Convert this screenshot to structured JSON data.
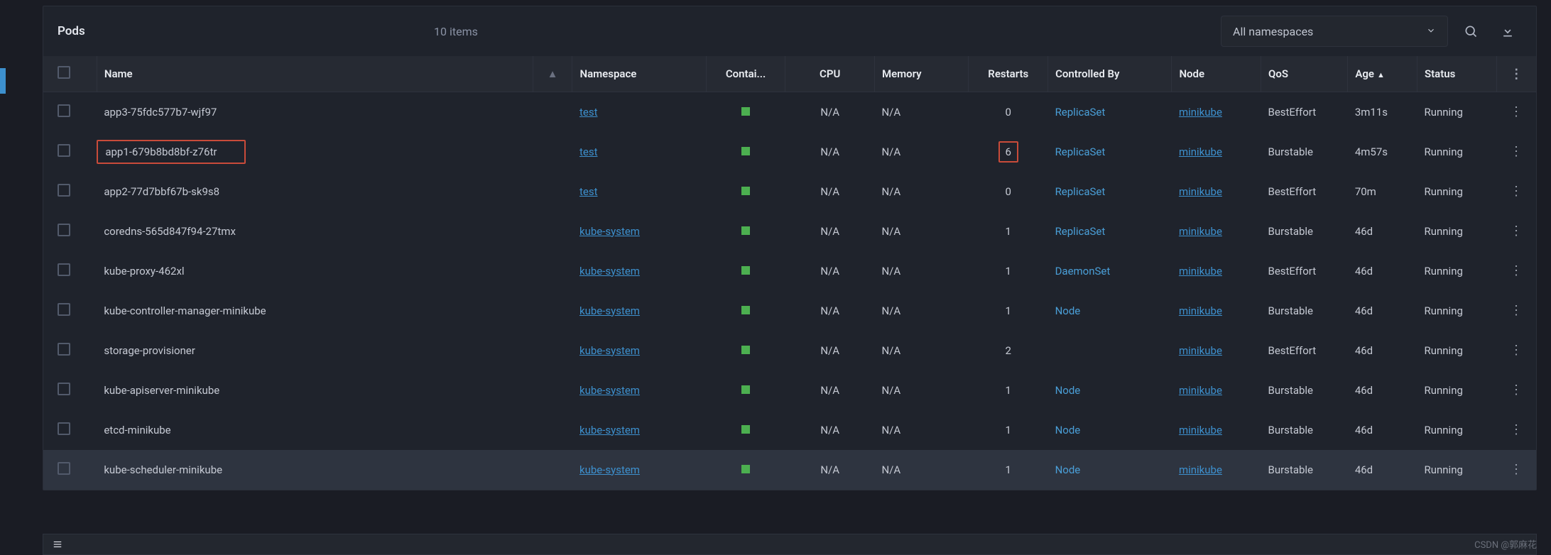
{
  "header": {
    "title": "Pods",
    "count": "10 items",
    "namespace_select": "All namespaces"
  },
  "columns": {
    "name": "Name",
    "namespace": "Namespace",
    "containers": "Contai...",
    "cpu": "CPU",
    "memory": "Memory",
    "restarts": "Restarts",
    "controlled_by": "Controlled By",
    "node": "Node",
    "qos": "QoS",
    "age": "Age",
    "status": "Status"
  },
  "rows": [
    {
      "name": "app3-75fdc577b7-wjf97",
      "ns": "test",
      "cpu": "N/A",
      "mem": "N/A",
      "restarts": "0",
      "ctrl": "ReplicaSet",
      "node": "minikube",
      "qos": "BestEffort",
      "age": "3m11s",
      "status": "Running",
      "highlight_name": false,
      "highlight_restarts": false
    },
    {
      "name": "app1-679b8bd8bf-z76tr",
      "ns": "test",
      "cpu": "N/A",
      "mem": "N/A",
      "restarts": "6",
      "ctrl": "ReplicaSet",
      "node": "minikube",
      "qos": "Burstable",
      "age": "4m57s",
      "status": "Running",
      "highlight_name": true,
      "highlight_restarts": true
    },
    {
      "name": "app2-77d7bbf67b-sk9s8",
      "ns": "test",
      "cpu": "N/A",
      "mem": "N/A",
      "restarts": "0",
      "ctrl": "ReplicaSet",
      "node": "minikube",
      "qos": "BestEffort",
      "age": "70m",
      "status": "Running",
      "highlight_name": false,
      "highlight_restarts": false
    },
    {
      "name": "coredns-565d847f94-27tmx",
      "ns": "kube-system",
      "cpu": "N/A",
      "mem": "N/A",
      "restarts": "1",
      "ctrl": "ReplicaSet",
      "node": "minikube",
      "qos": "Burstable",
      "age": "46d",
      "status": "Running",
      "highlight_name": false,
      "highlight_restarts": false
    },
    {
      "name": "kube-proxy-462xl",
      "ns": "kube-system",
      "cpu": "N/A",
      "mem": "N/A",
      "restarts": "1",
      "ctrl": "DaemonSet",
      "node": "minikube",
      "qos": "BestEffort",
      "age": "46d",
      "status": "Running",
      "highlight_name": false,
      "highlight_restarts": false
    },
    {
      "name": "kube-controller-manager-minikube",
      "ns": "kube-system",
      "cpu": "N/A",
      "mem": "N/A",
      "restarts": "1",
      "ctrl": "Node",
      "node": "minikube",
      "qos": "Burstable",
      "age": "46d",
      "status": "Running",
      "highlight_name": false,
      "highlight_restarts": false
    },
    {
      "name": "storage-provisioner",
      "ns": "kube-system",
      "cpu": "N/A",
      "mem": "N/A",
      "restarts": "2",
      "ctrl": "",
      "node": "minikube",
      "qos": "BestEffort",
      "age": "46d",
      "status": "Running",
      "highlight_name": false,
      "highlight_restarts": false
    },
    {
      "name": "kube-apiserver-minikube",
      "ns": "kube-system",
      "cpu": "N/A",
      "mem": "N/A",
      "restarts": "1",
      "ctrl": "Node",
      "node": "minikube",
      "qos": "Burstable",
      "age": "46d",
      "status": "Running",
      "highlight_name": false,
      "highlight_restarts": false
    },
    {
      "name": "etcd-minikube",
      "ns": "kube-system",
      "cpu": "N/A",
      "mem": "N/A",
      "restarts": "1",
      "ctrl": "Node",
      "node": "minikube",
      "qos": "Burstable",
      "age": "46d",
      "status": "Running",
      "highlight_name": false,
      "highlight_restarts": false
    },
    {
      "name": "kube-scheduler-minikube",
      "ns": "kube-system",
      "cpu": "N/A",
      "mem": "N/A",
      "restarts": "1",
      "ctrl": "Node",
      "node": "minikube",
      "qos": "Burstable",
      "age": "46d",
      "status": "Running",
      "highlight_name": false,
      "highlight_restarts": false,
      "hovered": true
    }
  ],
  "watermark": "CSDN @郭麻花"
}
